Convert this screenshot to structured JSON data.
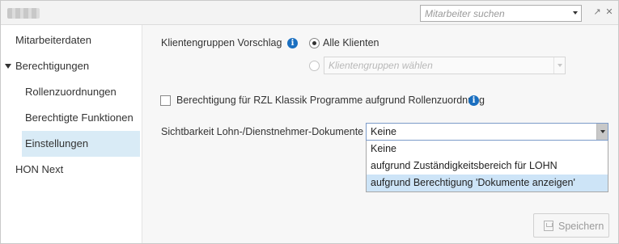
{
  "window": {
    "employee_search": {
      "placeholder": "Mitarbeiter suchen"
    },
    "icons": [
      "external-link-icon",
      "close-icon"
    ]
  },
  "sidebar": {
    "items": [
      {
        "label": "Mitarbeiterdaten"
      },
      {
        "label": "Berechtigungen",
        "expanded": true
      },
      {
        "label": "Rollenzuordnungen"
      },
      {
        "label": "Berechtigte Funktionen"
      },
      {
        "label": "Einstellungen",
        "selected": true
      },
      {
        "label": "HON Next"
      }
    ]
  },
  "settings": {
    "client_groups_label": "Klientengruppen Vorschlag",
    "all_clients_label": "Alle Klienten",
    "all_clients_selected": true,
    "client_groups_select_placeholder": "Klientengruppen wählen",
    "rzl_checkbox_label": "Berechtigung für RZL Klassik Programme aufgrund Rollenzuordnung",
    "rzl_checkbox_checked": false,
    "visibility_label": "Sichtbarkeit Lohn-/Dienstnehmer-Dokumente",
    "visibility_value": "Keine",
    "visibility_options": [
      {
        "label": "Keine"
      },
      {
        "label": "aufgrund Zuständigkeitsbereich für LOHN"
      },
      {
        "label": "aufgrund Berechtigung 'Dokumente anzeigen'",
        "highlighted": true
      }
    ]
  },
  "footer": {
    "save_label": "Speichern",
    "save_enabled": false
  },
  "colors": {
    "selection": "#d9ebf6",
    "info": "#1a6fc0",
    "hover": "#cde4f7"
  }
}
